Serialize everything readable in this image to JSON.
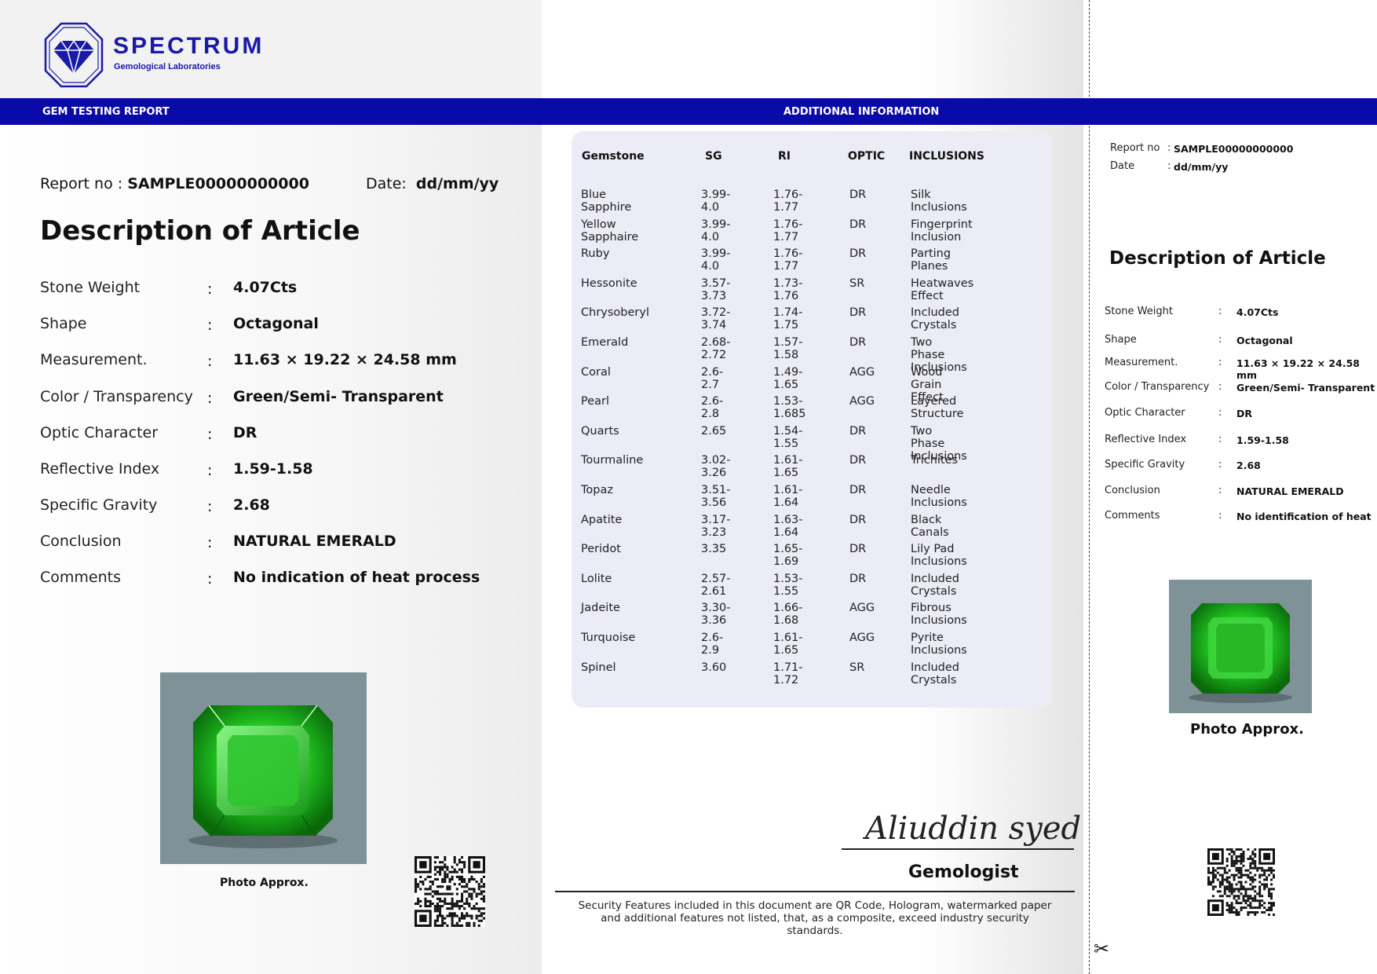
{
  "logo": {
    "name": "SPECTRUM",
    "subtitle": "Gemological Laboratories"
  },
  "bar": {
    "left": "GEM TESTING REPORT",
    "center": "ADDITIONAL INFORMATION"
  },
  "report": {
    "report_label": "Report no :",
    "report_no": "SAMPLE00000000000",
    "date_label": "Date:",
    "date": "dd/mm/yy",
    "title": "Description of Article",
    "fields": [
      {
        "label": "Stone Weight",
        "value": "4.07Cts"
      },
      {
        "label": "Shape",
        "value": "Octagonal"
      },
      {
        "label": "Measurement.",
        "value": "11.63 × 19.22 × 24.58 mm"
      },
      {
        "label": "Color / Transparency",
        "value": "Green/Semi- Transparent"
      },
      {
        "label": "Optic Character",
        "value": "DR"
      },
      {
        "label": "Reflective Index",
        "value": " 1.59-1.58"
      },
      {
        "label": "Specific Gravity",
        "value": "2.68"
      },
      {
        "label": "Conclusion",
        "value": "NATURAL EMERALD"
      },
      {
        "label": "Comments",
        "value": "No indication of heat process"
      }
    ],
    "photo_caption": "Photo Approx."
  },
  "table": {
    "headers": [
      "Gemstone",
      "SG",
      "RI",
      "OPTIC",
      "INCLUSIONS"
    ],
    "rows": [
      [
        "Blue Sapphire",
        "3.99-4.0",
        "1.76-1.77",
        "DR",
        "Silk Inclusions"
      ],
      [
        "Yellow Sapphaire",
        "3.99- 4.0",
        "1.76-1.77",
        "DR",
        "Fingerprint Inclusion"
      ],
      [
        "Ruby",
        "3.99-4.0",
        "1.76-1.77",
        "DR",
        "Parting Planes"
      ],
      [
        "Hessonite",
        "3.57-3.73",
        "1.73-1.76",
        "SR",
        "Heatwaves Effect"
      ],
      [
        "Chrysoberyl",
        "3.72-3.74",
        "1.74-1.75",
        "DR",
        "Included Crystals"
      ],
      [
        "Emerald",
        "2.68-2.72",
        "1.57-1.58",
        "DR",
        "Two Phase Inclusions"
      ],
      [
        "Coral",
        "2.6-2.7",
        "1.49-1.65",
        "AGG",
        "Wood Grain Effect"
      ],
      [
        "Pearl",
        "2.6-2.8",
        "1.53-1.685",
        "AGG",
        "Layered Structure"
      ],
      [
        "Quarts",
        "2.65",
        "1.54-1.55",
        "DR",
        "Two Phase Inclusions"
      ],
      [
        "Tourmaline",
        "3.02-3.26",
        "1.61-1.65",
        "DR",
        "Trichites"
      ],
      [
        "Topaz",
        "3.51-3.56",
        "1.61-1.64",
        "DR",
        "Needle Inclusions"
      ],
      [
        "Apatite",
        "3.17-3.23",
        "1.63-1.64",
        "DR",
        "Black Canals"
      ],
      [
        "Peridot",
        "3.35",
        "1.65-1.69",
        "DR",
        "Lily Pad Inclusions"
      ],
      [
        "Lolite",
        "2.57-2.61",
        "1.53-1.55",
        "DR",
        "Included Crystals"
      ],
      [
        "Jadeite",
        "3.30-3.36",
        "1.66-1.68",
        "AGG",
        "Fibrous Inclusions"
      ],
      [
        "Turquoise",
        "2.6-2.9",
        "1.61-1.65",
        "AGG",
        "Pyrite Inclusions"
      ],
      [
        "Spinel",
        "3.60",
        "1.71-1.72",
        "SR",
        "Included Crystals"
      ]
    ]
  },
  "signature": {
    "name": "Aliuddin syed",
    "role": "Gemologist"
  },
  "security_text": "Security Features included in this document are QR Code, Hologram, watermarked paper and additional features not listed, that, as a composite, exceed industry security standards.",
  "stub": {
    "report_label": "Report no",
    "report_no": "SAMPLE00000000000",
    "date_label": "Date",
    "date": "dd/mm/yy",
    "title": "Description of Article",
    "fields": [
      {
        "label": "Stone Weight",
        "value": "4.07Cts"
      },
      {
        "label": "Shape",
        "value": "Octagonal"
      },
      {
        "label": "Measurement.",
        "value": "11.63 × 19.22 × 24.58 mm"
      },
      {
        "label": "Color / Transparency",
        "value": "Green/Semi- Transparent"
      },
      {
        "label": "Optic Character",
        "value": "DR"
      },
      {
        "label": "Reflective Index",
        "value": " 1.59-1.58"
      },
      {
        "label": "Specific Gravity",
        "value": "2.68"
      },
      {
        "label": "Conclusion",
        "value": "NATURAL EMERALD"
      },
      {
        "label": "Comments",
        "value": "No identification of heat"
      }
    ],
    "photo_caption": "Photo Approx."
  },
  "colors": {
    "brand_blue": "#0a0aa8",
    "logo_blue": "#1a1aa8",
    "table_bg": "#ececf7",
    "photo_bg": "#7e9298"
  },
  "icons": {
    "logo": "diamond-octagon-icon",
    "qr": "qr-code-icon",
    "cut": "scissors-icon"
  }
}
